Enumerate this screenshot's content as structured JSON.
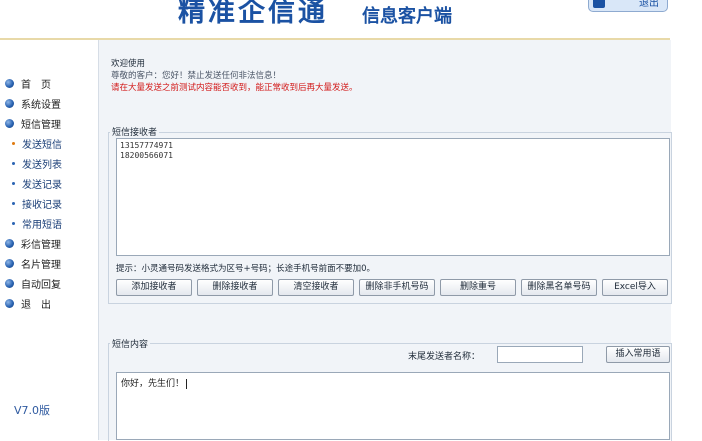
{
  "header": {
    "title": "精准企信通",
    "subtitle": "信息客户端",
    "logout_label": "退出"
  },
  "sidebar": {
    "items": [
      {
        "label": "首　页",
        "icon": "home-icon"
      },
      {
        "label": "系统设置",
        "icon": "settings-icon"
      },
      {
        "label": "短信管理",
        "icon": "sms-icon"
      }
    ],
    "sms_sub": [
      {
        "label": "发送短信",
        "active": true
      },
      {
        "label": "发送列表"
      },
      {
        "label": "发送记录"
      },
      {
        "label": "接收记录"
      },
      {
        "label": "常用短语"
      }
    ],
    "more_items": [
      {
        "label": "彩信管理"
      },
      {
        "label": "名片管理"
      },
      {
        "label": "自动回复"
      },
      {
        "label": "退　出"
      }
    ],
    "version": "V7.0版"
  },
  "welcome": {
    "title": "欢迎使用",
    "greeting": "尊敬的客户：您好！禁止发送任何非法信息！",
    "warning": "请在大量发送之前测试内容能否收到，能正常收到后再大量发送。"
  },
  "recipients": {
    "legend": "短信接收者",
    "numbers_text": "13157774971\n18200566071",
    "hint": "提示：小灵通号码发送格式为区号+号码；长途手机号前面不要加0。",
    "buttons": [
      "添加接收者",
      "删除接收者",
      "清空接收者",
      "删除非手机号码",
      "删除重号",
      "删除黑名单号码",
      "Excel导入"
    ]
  },
  "content": {
    "legend": "短信内容",
    "sender_label": "末尾发送者名称：",
    "sender_value": "",
    "insert_label": "插入常用语",
    "message": "你好，先生们！"
  },
  "colors": {
    "brand": "#1b52a3",
    "warning": "#d21a1a",
    "active_bullet": "#e07a10",
    "panel_bg": "#f1f4f8"
  }
}
